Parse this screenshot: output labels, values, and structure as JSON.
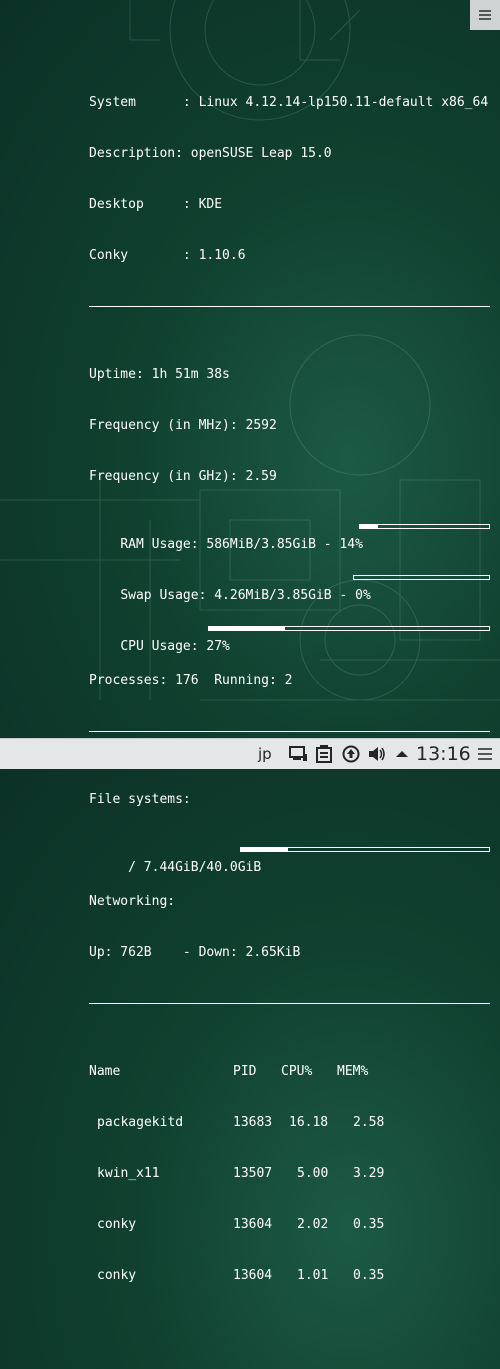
{
  "system_info": {
    "system": "System      : Linux 4.12.14-lp150.11-default x86_64",
    "description": "Description: openSUSE Leap 15.0",
    "desktop": "Desktop     : KDE",
    "conky": "Conky       : 1.10.6"
  },
  "stats": {
    "uptime": "Uptime: 1h 51m 38s",
    "freq_mhz": "Frequency (in MHz): 2592",
    "freq_ghz": "Frequency (in GHz): 2.59",
    "ram": "RAM Usage: 586MiB/3.85GiB - 14%",
    "ram_percent": 14,
    "swap": "Swap Usage: 4.26MiB/3.85GiB - 0%",
    "swap_percent": 0,
    "cpu": "CPU Usage: 27%",
    "cpu_percent": 27,
    "processes": "Processes: 176  Running: 2"
  },
  "storage": {
    "heading": "File systems:",
    "root": " / 7.44GiB/40.0GiB",
    "root_percent": 19,
    "net_heading": "Networking:",
    "net": "Up: 762B    - Down: 2.65KiB"
  },
  "processes": {
    "headers": [
      "Name",
      "PID",
      "CPU%",
      "MEM%"
    ],
    "rows": [
      [
        "packagekitd",
        "13683",
        "16.18",
        "2.58"
      ],
      [
        "kwin_x11",
        "13507",
        "5.00",
        "3.29"
      ],
      [
        "conky",
        "13604",
        "2.02",
        "0.35"
      ],
      [
        "conky",
        "13604",
        "1.01",
        "0.35"
      ]
    ]
  },
  "taskbar": {
    "language": "jp",
    "clock": "13:16"
  },
  "colors": {
    "background": "#10402f",
    "text": "#ffffff",
    "taskbar": "#e4e6e7"
  },
  "icons": [
    "menu-icon",
    "network-icon",
    "clipboard-icon",
    "updates-icon",
    "volume-icon",
    "tray-expand-icon",
    "taskbar-menu-icon"
  ]
}
